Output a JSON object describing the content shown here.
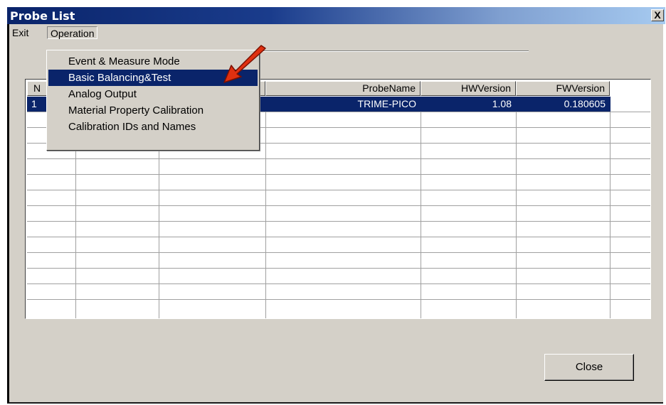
{
  "window": {
    "title": "Probe List",
    "close_glyph": "X"
  },
  "menubar": {
    "exit": "Exit",
    "operation": "Operation"
  },
  "dropdown": {
    "items": [
      "Event & Measure Mode",
      "Basic Balancing&Test",
      "Analog Output",
      "Material Property Calibration",
      "Calibration IDs and Names"
    ],
    "highlighted_index": 1
  },
  "grid": {
    "columns": [
      "N",
      "",
      "",
      "ProbeName",
      "HWVersion",
      "FWVersion"
    ],
    "rows": [
      {
        "no": "1",
        "probe_name": "TRIME-PICO",
        "hw_version": "1.08",
        "fw_version": "0.180605",
        "selected": true
      }
    ]
  },
  "buttons": {
    "close": "Close"
  },
  "colors": {
    "title_start": "#0a246a",
    "title_end": "#a6caf0",
    "selection": "#0a246a",
    "face": "#d4d0c8",
    "arrow": "#e03010"
  },
  "icons": {
    "annotation_arrow": "red-arrow-icon"
  }
}
